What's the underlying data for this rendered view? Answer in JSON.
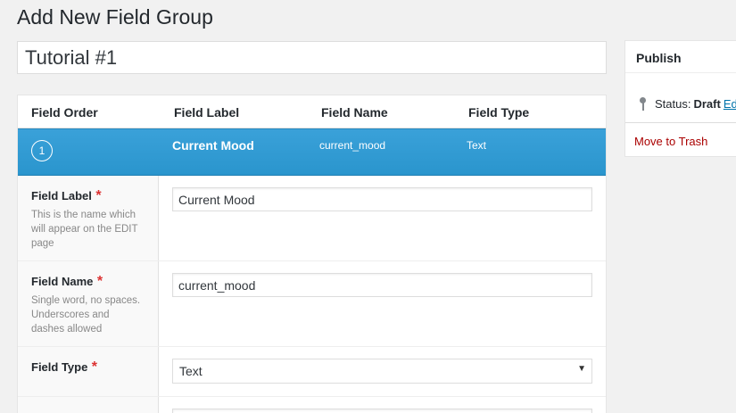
{
  "page": {
    "title": "Add New Field Group"
  },
  "title_input": {
    "value": "Tutorial #1"
  },
  "fields_table": {
    "headers": {
      "order": "Field Order",
      "label": "Field Label",
      "name": "Field Name",
      "type": "Field Type"
    },
    "row": {
      "order": "1",
      "label": "Current Mood",
      "name": "current_mood",
      "type": "Text"
    }
  },
  "settings": {
    "label": {
      "name": "Field Label",
      "required": "*",
      "desc": "This is the name which will appear on the EDIT page",
      "value": "Current Mood"
    },
    "name": {
      "name": "Field Name",
      "required": "*",
      "desc": "Single word, no spaces. Underscores and dashes allowed",
      "value": "current_mood"
    },
    "type": {
      "name": "Field Type",
      "required": "*",
      "value": "Text",
      "arrow": "▼"
    }
  },
  "publish": {
    "title": "Publish",
    "status_label": "Status:",
    "status_value": "Draft",
    "edit_link": "Edit",
    "trash": "Move to Trash"
  }
}
